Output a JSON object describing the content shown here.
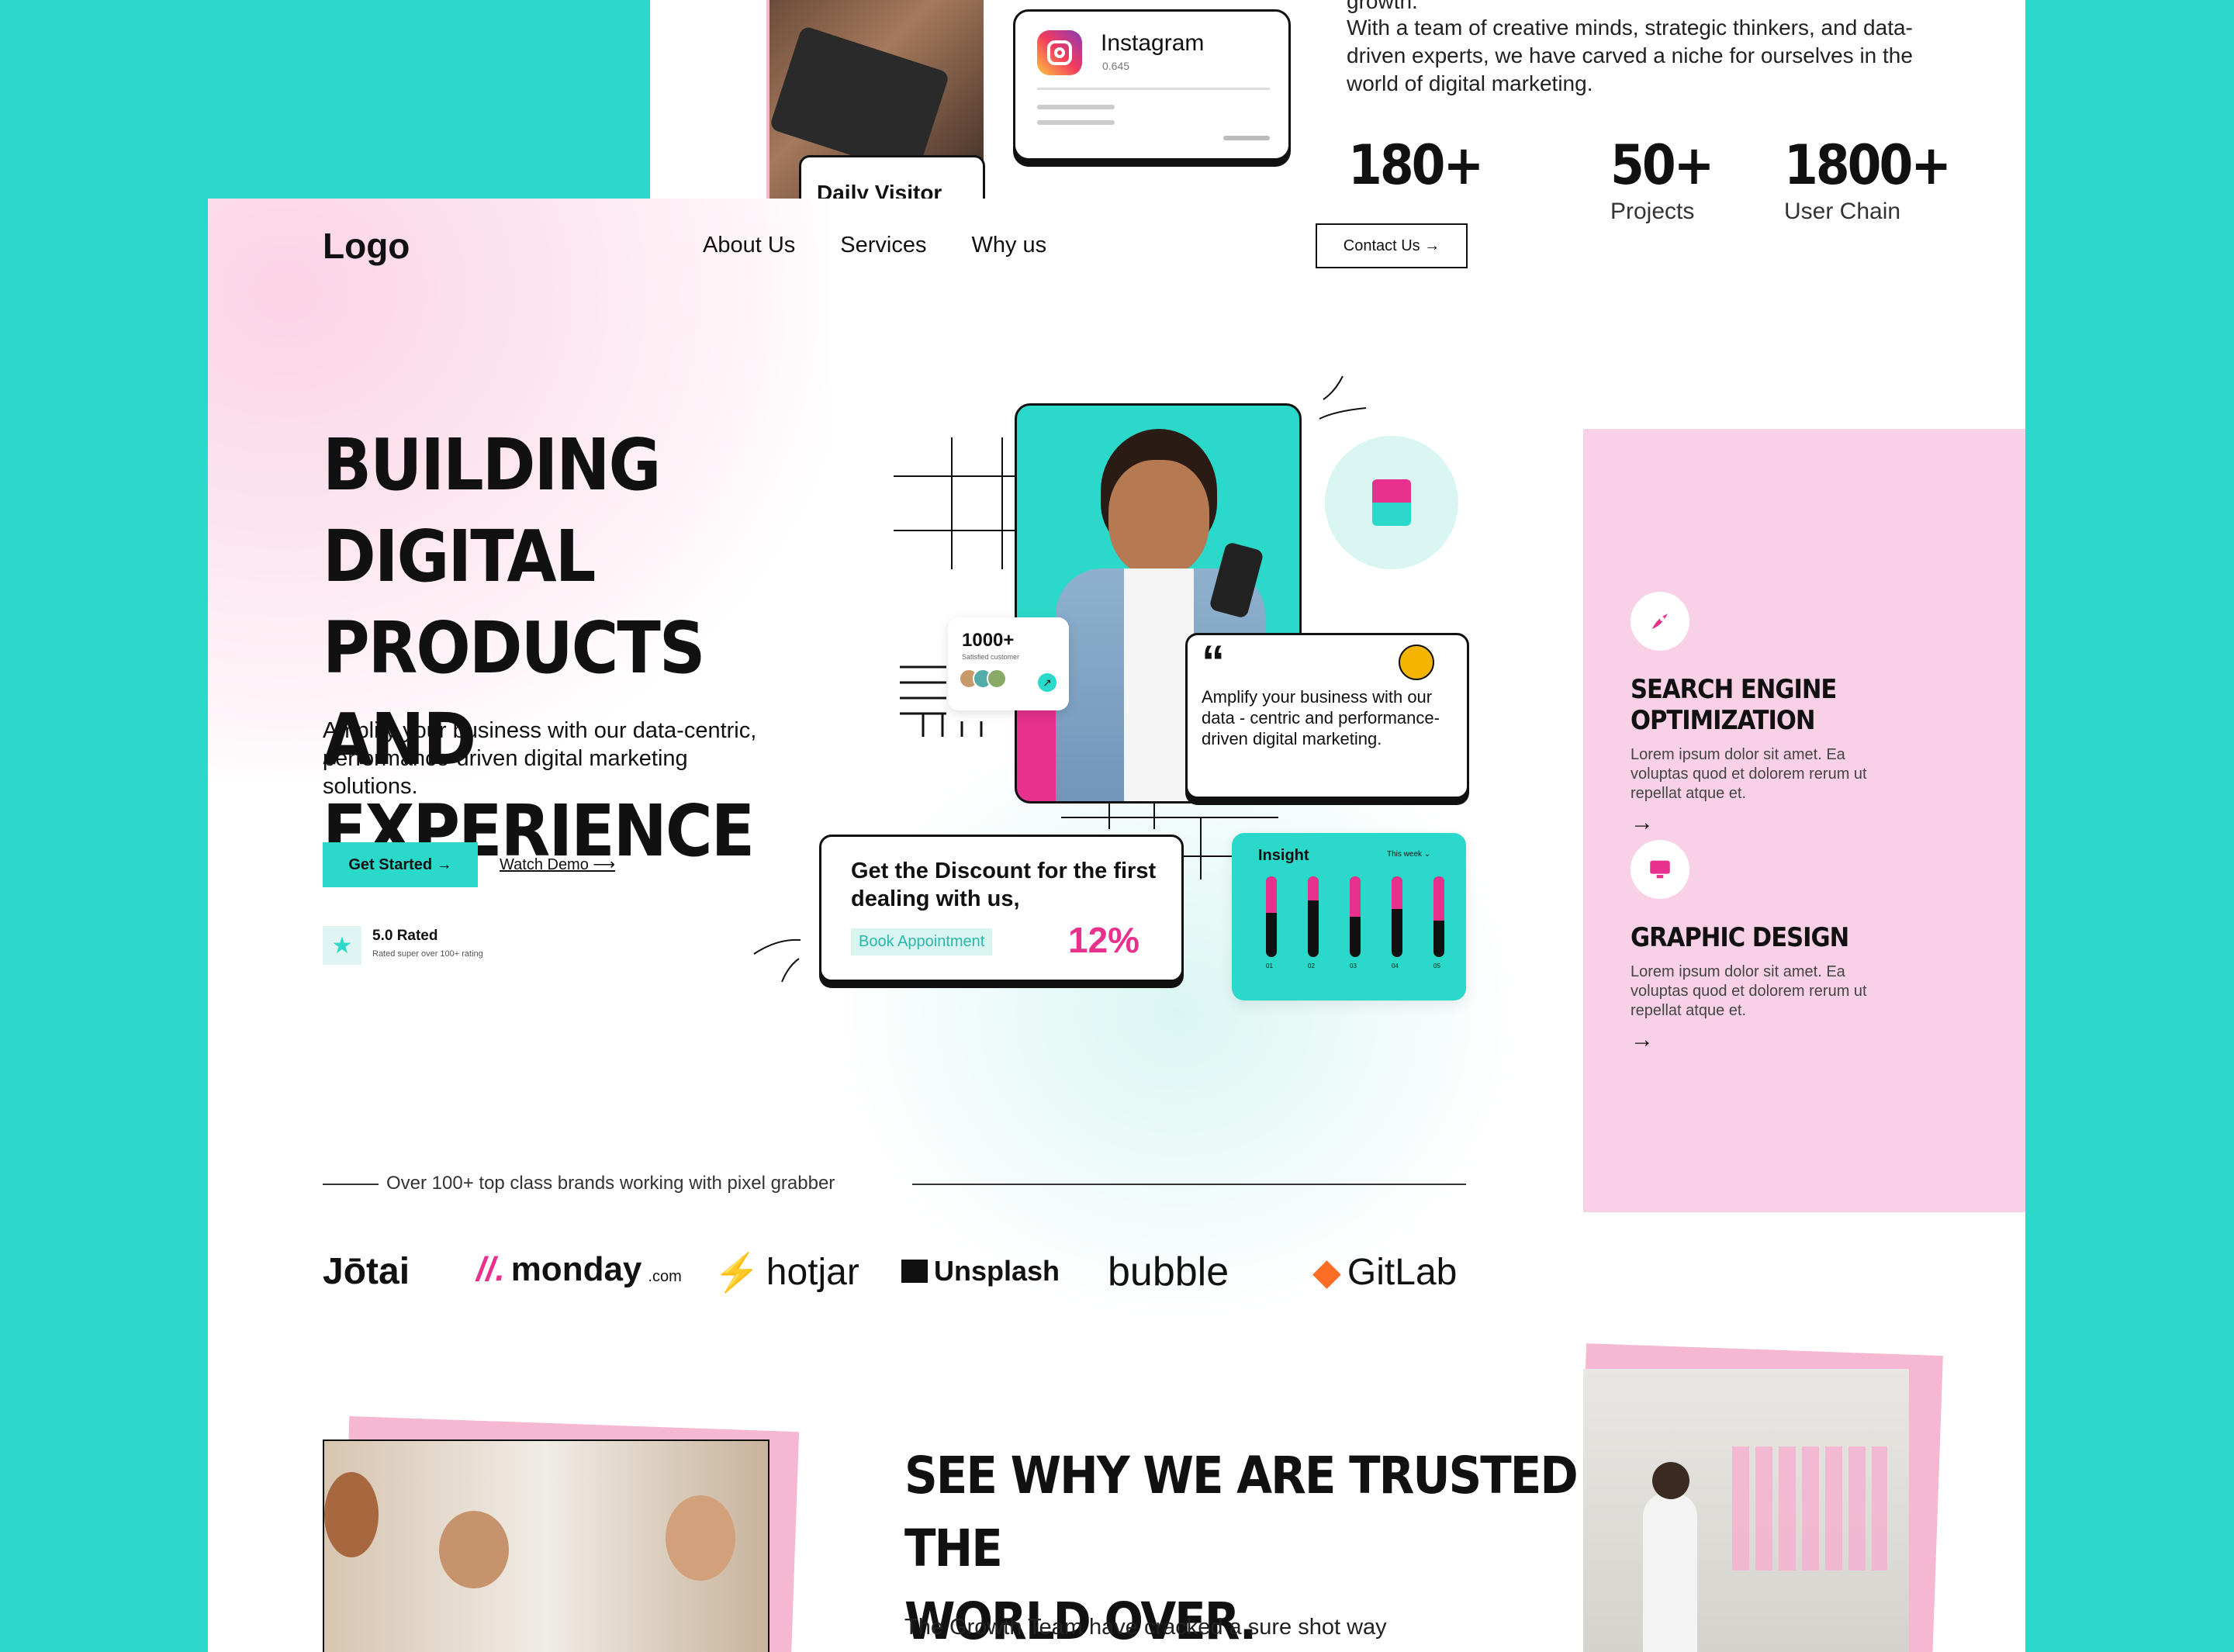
{
  "back": {
    "about_text_top": "growth.",
    "about_text": "With a team of creative minds, strategic thinkers, and data-driven experts, we have carved a niche for ourselves in the world of digital marketing.",
    "instagram_card": {
      "title": "Instagram",
      "sub": "0.645"
    },
    "daily_visitor": "Daily Visitor",
    "stats": [
      {
        "num": "180+",
        "label": ""
      },
      {
        "num": "50+",
        "label": "Projects"
      },
      {
        "num": "1800+",
        "label": "User Chain"
      }
    ],
    "services": [
      {
        "title": "SEARCH ENGINE OPTIMIZATION",
        "desc": "Lorem ipsum dolor sit amet. Ea voluptas quod et dolorem rerum ut repellat atque et.",
        "arrow": "→",
        "icon": "rocket-icon"
      },
      {
        "title": "GRAPHIC DESIGN",
        "desc": "Lorem ipsum dolor sit amet. Ea voluptas quod et dolorem rerum ut repellat atque et.",
        "arrow": "→",
        "icon": "monitor-icon"
      }
    ]
  },
  "front": {
    "logo": "Logo",
    "nav": {
      "about": "About Us",
      "services": "Services",
      "why": "Why us",
      "contact": "Contact Us →"
    },
    "hero": {
      "title_1": "BUILDING DIGITAL",
      "title_2": "PRODUCTS AND",
      "title_3": "EXPERIENCE",
      "subtitle": "Amplify your business with our data-centric, performance-driven digital marketing solutions.",
      "get_started": "Get Started →",
      "watch_demo": "Watch Demo ⟶",
      "rating": "5.0 Rated",
      "rating_sub": "Rated super over 100+ rating"
    },
    "users_card": {
      "count": "1000+",
      "sub": "Satisfied customer"
    },
    "quote_card": {
      "mark": "“",
      "text": "Amplify your business with our data - centric and performance-driven digital marketing."
    },
    "discount_card": {
      "title": "Get the Discount for the first dealing with us,",
      "button": "Book Appointment",
      "percent": "12%"
    },
    "insight_card": {
      "title": "Insight",
      "period": "This week ⌄",
      "bars": [
        0.55,
        0.7,
        0.5,
        0.6,
        0.45
      ],
      "labels": [
        "01",
        "02",
        "03",
        "04",
        "05"
      ]
    },
    "brands_heading": "Over 100+ top class brands working with pixel grabber",
    "brands": [
      "Jōtai",
      "monday",
      "hotjar",
      "Unsplash",
      "bubble",
      "GitLab"
    ],
    "brand_monday_suffix": ".com",
    "trusted_title_1": "SEE WHY WE ARE TRUSTED THE",
    "trusted_title_2": "WORLD OVER.",
    "trusted_text": "The Growth Team have cracked a sure shot way"
  },
  "colors": {
    "teal": "#2bd9ca",
    "pink": "#e7318d",
    "light_pink": "#f8d1e6"
  }
}
